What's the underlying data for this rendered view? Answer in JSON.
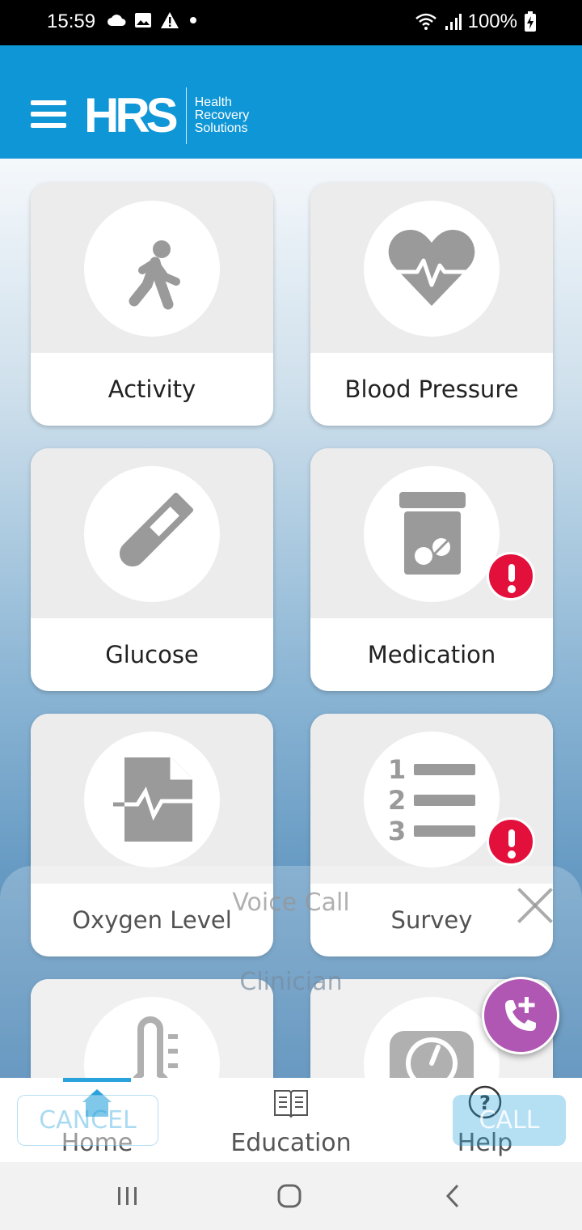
{
  "status_bar": {
    "time": "15:59",
    "battery": "100%",
    "icons": [
      "cloud-icon",
      "image-icon",
      "warning-icon",
      "dot-icon",
      "wifi-icon",
      "signal-icon",
      "battery-charging-icon"
    ]
  },
  "header": {
    "logo_text": "HRS",
    "logo_tagline": [
      "Health",
      "Recovery",
      "Solutions"
    ],
    "brand_color": "#0f96d6"
  },
  "tiles": [
    {
      "label": "Activity",
      "icon": "walking-person-icon",
      "alert": false
    },
    {
      "label": "Blood Pressure",
      "icon": "heart-pulse-icon",
      "alert": false
    },
    {
      "label": "Glucose",
      "icon": "test-tube-icon",
      "alert": false
    },
    {
      "label": "Medication",
      "icon": "pill-bottle-icon",
      "alert": true
    },
    {
      "label": "Oxygen Level",
      "icon": "file-pulse-icon",
      "alert": false
    },
    {
      "label": "Survey",
      "icon": "numbered-list-icon",
      "alert": true
    },
    {
      "label": "",
      "icon": "thermometer-icon",
      "alert": false
    },
    {
      "label": "",
      "icon": "scale-icon",
      "alert": false
    }
  ],
  "overlay": {
    "title": "Voice Call",
    "subtitle": "Clinician",
    "cancel_label": "CANCEL",
    "call_label": "CALL"
  },
  "bottom_nav": {
    "items": [
      {
        "label": "Home",
        "icon": "home-icon",
        "active": true
      },
      {
        "label": "Education",
        "icon": "book-icon",
        "active": false
      },
      {
        "label": "Help",
        "icon": "help-icon",
        "active": false
      }
    ]
  },
  "colors": {
    "alert": "#e3103c",
    "fab": "#b057b4",
    "accent": "#2aa3dc"
  }
}
